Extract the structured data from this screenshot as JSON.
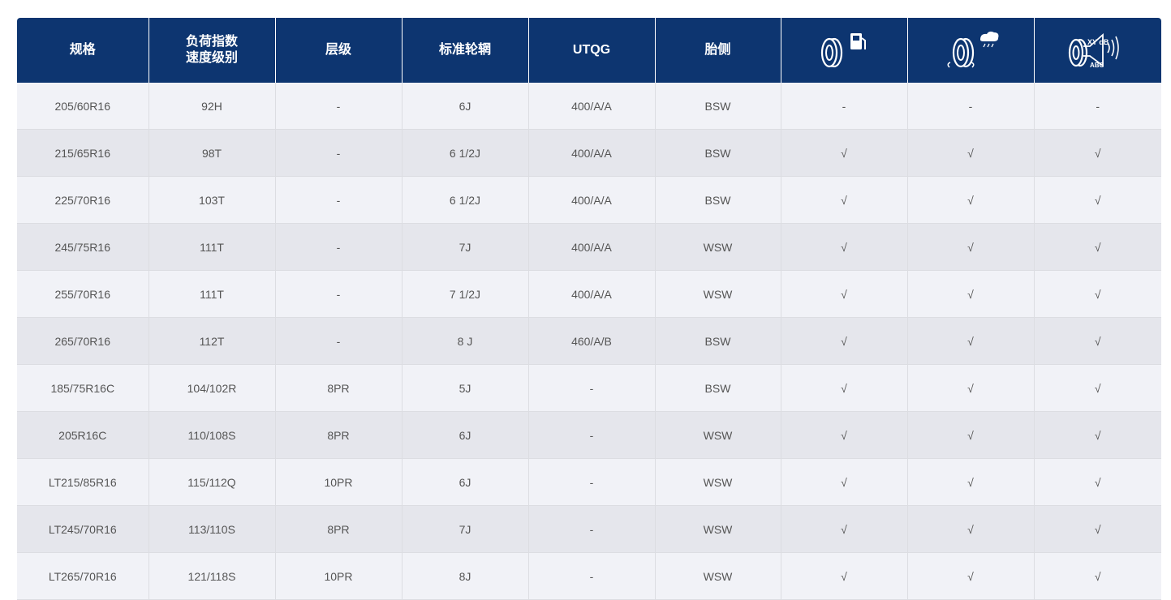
{
  "table": {
    "headers": {
      "spec": "规格",
      "load_line1": "负荷指数",
      "load_line2": "速度级别",
      "ply": "层级",
      "rim": "标准轮辋",
      "utqg": "UTQG",
      "sidewall": "胎侧",
      "fuel_icon": "tire-fuel-efficiency-icon",
      "wet_icon": "tire-wet-grip-icon",
      "noise_icon": "tire-noise-icon",
      "noise_icon_text_top": "XY dB",
      "noise_icon_text_bottom": "ABC"
    },
    "rows": [
      {
        "spec": "205/60R16",
        "load": "92H",
        "ply": "-",
        "rim": "6J",
        "utqg": "400/A/A",
        "sidewall": "BSW",
        "fuel": "-",
        "wet": "-",
        "noise": "-"
      },
      {
        "spec": "215/65R16",
        "load": "98T",
        "ply": "-",
        "rim": "6 1/2J",
        "utqg": "400/A/A",
        "sidewall": "BSW",
        "fuel": "√",
        "wet": "√",
        "noise": "√"
      },
      {
        "spec": "225/70R16",
        "load": "103T",
        "ply": "-",
        "rim": "6 1/2J",
        "utqg": "400/A/A",
        "sidewall": "BSW",
        "fuel": "√",
        "wet": "√",
        "noise": "√"
      },
      {
        "spec": "245/75R16",
        "load": "111T",
        "ply": "-",
        "rim": "7J",
        "utqg": "400/A/A",
        "sidewall": "WSW",
        "fuel": "√",
        "wet": "√",
        "noise": "√"
      },
      {
        "spec": "255/70R16",
        "load": "111T",
        "ply": "-",
        "rim": "7 1/2J",
        "utqg": "400/A/A",
        "sidewall": "WSW",
        "fuel": "√",
        "wet": "√",
        "noise": "√"
      },
      {
        "spec": "265/70R16",
        "load": "112T",
        "ply": "-",
        "rim": "8 J",
        "utqg": "460/A/B",
        "sidewall": "BSW",
        "fuel": "√",
        "wet": "√",
        "noise": "√"
      },
      {
        "spec": "185/75R16C",
        "load": "104/102R",
        "ply": "8PR",
        "rim": "5J",
        "utqg": "-",
        "sidewall": "BSW",
        "fuel": "√",
        "wet": "√",
        "noise": "√"
      },
      {
        "spec": "205R16C",
        "load": "110/108S",
        "ply": "8PR",
        "rim": "6J",
        "utqg": "-",
        "sidewall": "WSW",
        "fuel": "√",
        "wet": "√",
        "noise": "√"
      },
      {
        "spec": "LT215/85R16",
        "load": "115/112Q",
        "ply": "10PR",
        "rim": "6J",
        "utqg": "-",
        "sidewall": "WSW",
        "fuel": "√",
        "wet": "√",
        "noise": "√"
      },
      {
        "spec": "LT245/70R16",
        "load": "113/110S",
        "ply": "8PR",
        "rim": "7J",
        "utqg": "-",
        "sidewall": "WSW",
        "fuel": "√",
        "wet": "√",
        "noise": "√"
      },
      {
        "spec": "LT265/70R16",
        "load": "121/118S",
        "ply": "10PR",
        "rim": "8J",
        "utqg": "-",
        "sidewall": "WSW",
        "fuel": "√",
        "wet": "√",
        "noise": "√"
      }
    ]
  }
}
